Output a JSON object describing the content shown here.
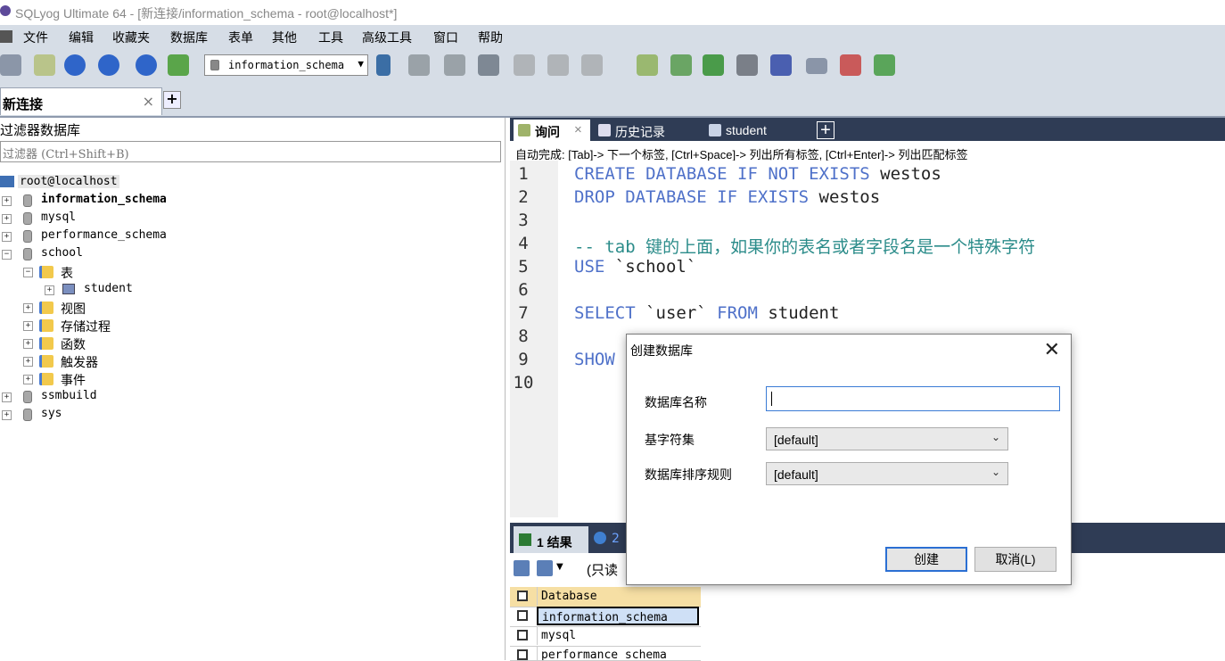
{
  "window": {
    "title": "SQLyog Ultimate 64 - [新连接/information_schema - root@localhost*]"
  },
  "menu": [
    "文件",
    "编辑",
    "收藏夹",
    "数据库",
    "表单",
    "其他",
    "工具",
    "高级工具",
    "窗口",
    "帮助"
  ],
  "toolbar": {
    "database_combo": "information_schema"
  },
  "connection_tab": {
    "label": "新连接",
    "close": "×",
    "add": "+"
  },
  "object_browser": {
    "title": "过滤器数据库",
    "filter_placeholder": "过滤器 (Ctrl+Shift+B)",
    "root": "root@localhost",
    "databases": [
      {
        "name": "information_schema",
        "bold": true,
        "expander": "+"
      },
      {
        "name": "mysql",
        "expander": "+"
      },
      {
        "name": "performance_schema",
        "expander": "+"
      },
      {
        "name": "school",
        "expander": "−"
      },
      {
        "name": "ssmbuild",
        "expander": "+"
      },
      {
        "name": "sys",
        "expander": "+"
      }
    ],
    "school_children": {
      "tables": "表",
      "student": "student",
      "views": "视图",
      "procedures": "存储过程",
      "functions": "函数",
      "triggers": "触发器",
      "events": "事件"
    }
  },
  "editor_tabs": [
    {
      "label": "询问",
      "close": "×"
    },
    {
      "label": "历史记录"
    },
    {
      "label": "student"
    }
  ],
  "editor_add_tab": "+",
  "autocomplete_hint": "自动完成: [Tab]-> 下一个标签, [Ctrl+Space]-> 列出所有标签, [Ctrl+Enter]-> 列出匹配标签",
  "editor": {
    "line_numbers": [
      "1",
      "2",
      "3",
      "4",
      "5",
      "6",
      "7",
      "8",
      "9",
      "10"
    ],
    "lines": [
      {
        "kw": "CREATE DATABASE IF NOT EXISTS",
        "rest": " westos"
      },
      {
        "kw": "DROP DATABASE IF EXISTS",
        "rest": " westos"
      },
      {
        "kw": "",
        "rest": ""
      },
      {
        "comment": "-- tab 键的上面，如果你的表名或者字段名是一个特殊字符"
      },
      {
        "kw": "USE",
        "rest": " `school`"
      },
      {
        "kw": "",
        "rest": ""
      },
      {
        "kw": "SELECT",
        "mid": " `user` ",
        "kw2": "FROM",
        "rest": " student"
      },
      {
        "kw": "",
        "rest": ""
      },
      {
        "kw": "SHOW",
        "rest": ""
      },
      {
        "kw": "",
        "rest": ""
      }
    ]
  },
  "results": {
    "tab1": "1 结果",
    "tab2": "2",
    "readonly": "(只读",
    "grid_header": "Database",
    "rows": [
      "information_schema",
      "mysql",
      "performance_schema"
    ]
  },
  "dialog": {
    "title": "创建数据库",
    "close": "✕",
    "name_label": "数据库名称",
    "name_value": "",
    "charset_label": "基字符集",
    "charset_value": "[default]",
    "collation_label": "数据库排序规则",
    "collation_value": "[default]",
    "create_button": "创建",
    "cancel_button": "取消(L)"
  },
  "colors": {
    "tab_bar": "#2f3c55",
    "menu_bg": "#d6dde6",
    "keyword": "#4f71c9",
    "comment": "#2b8c8a",
    "focus": "#2b6fd3"
  }
}
